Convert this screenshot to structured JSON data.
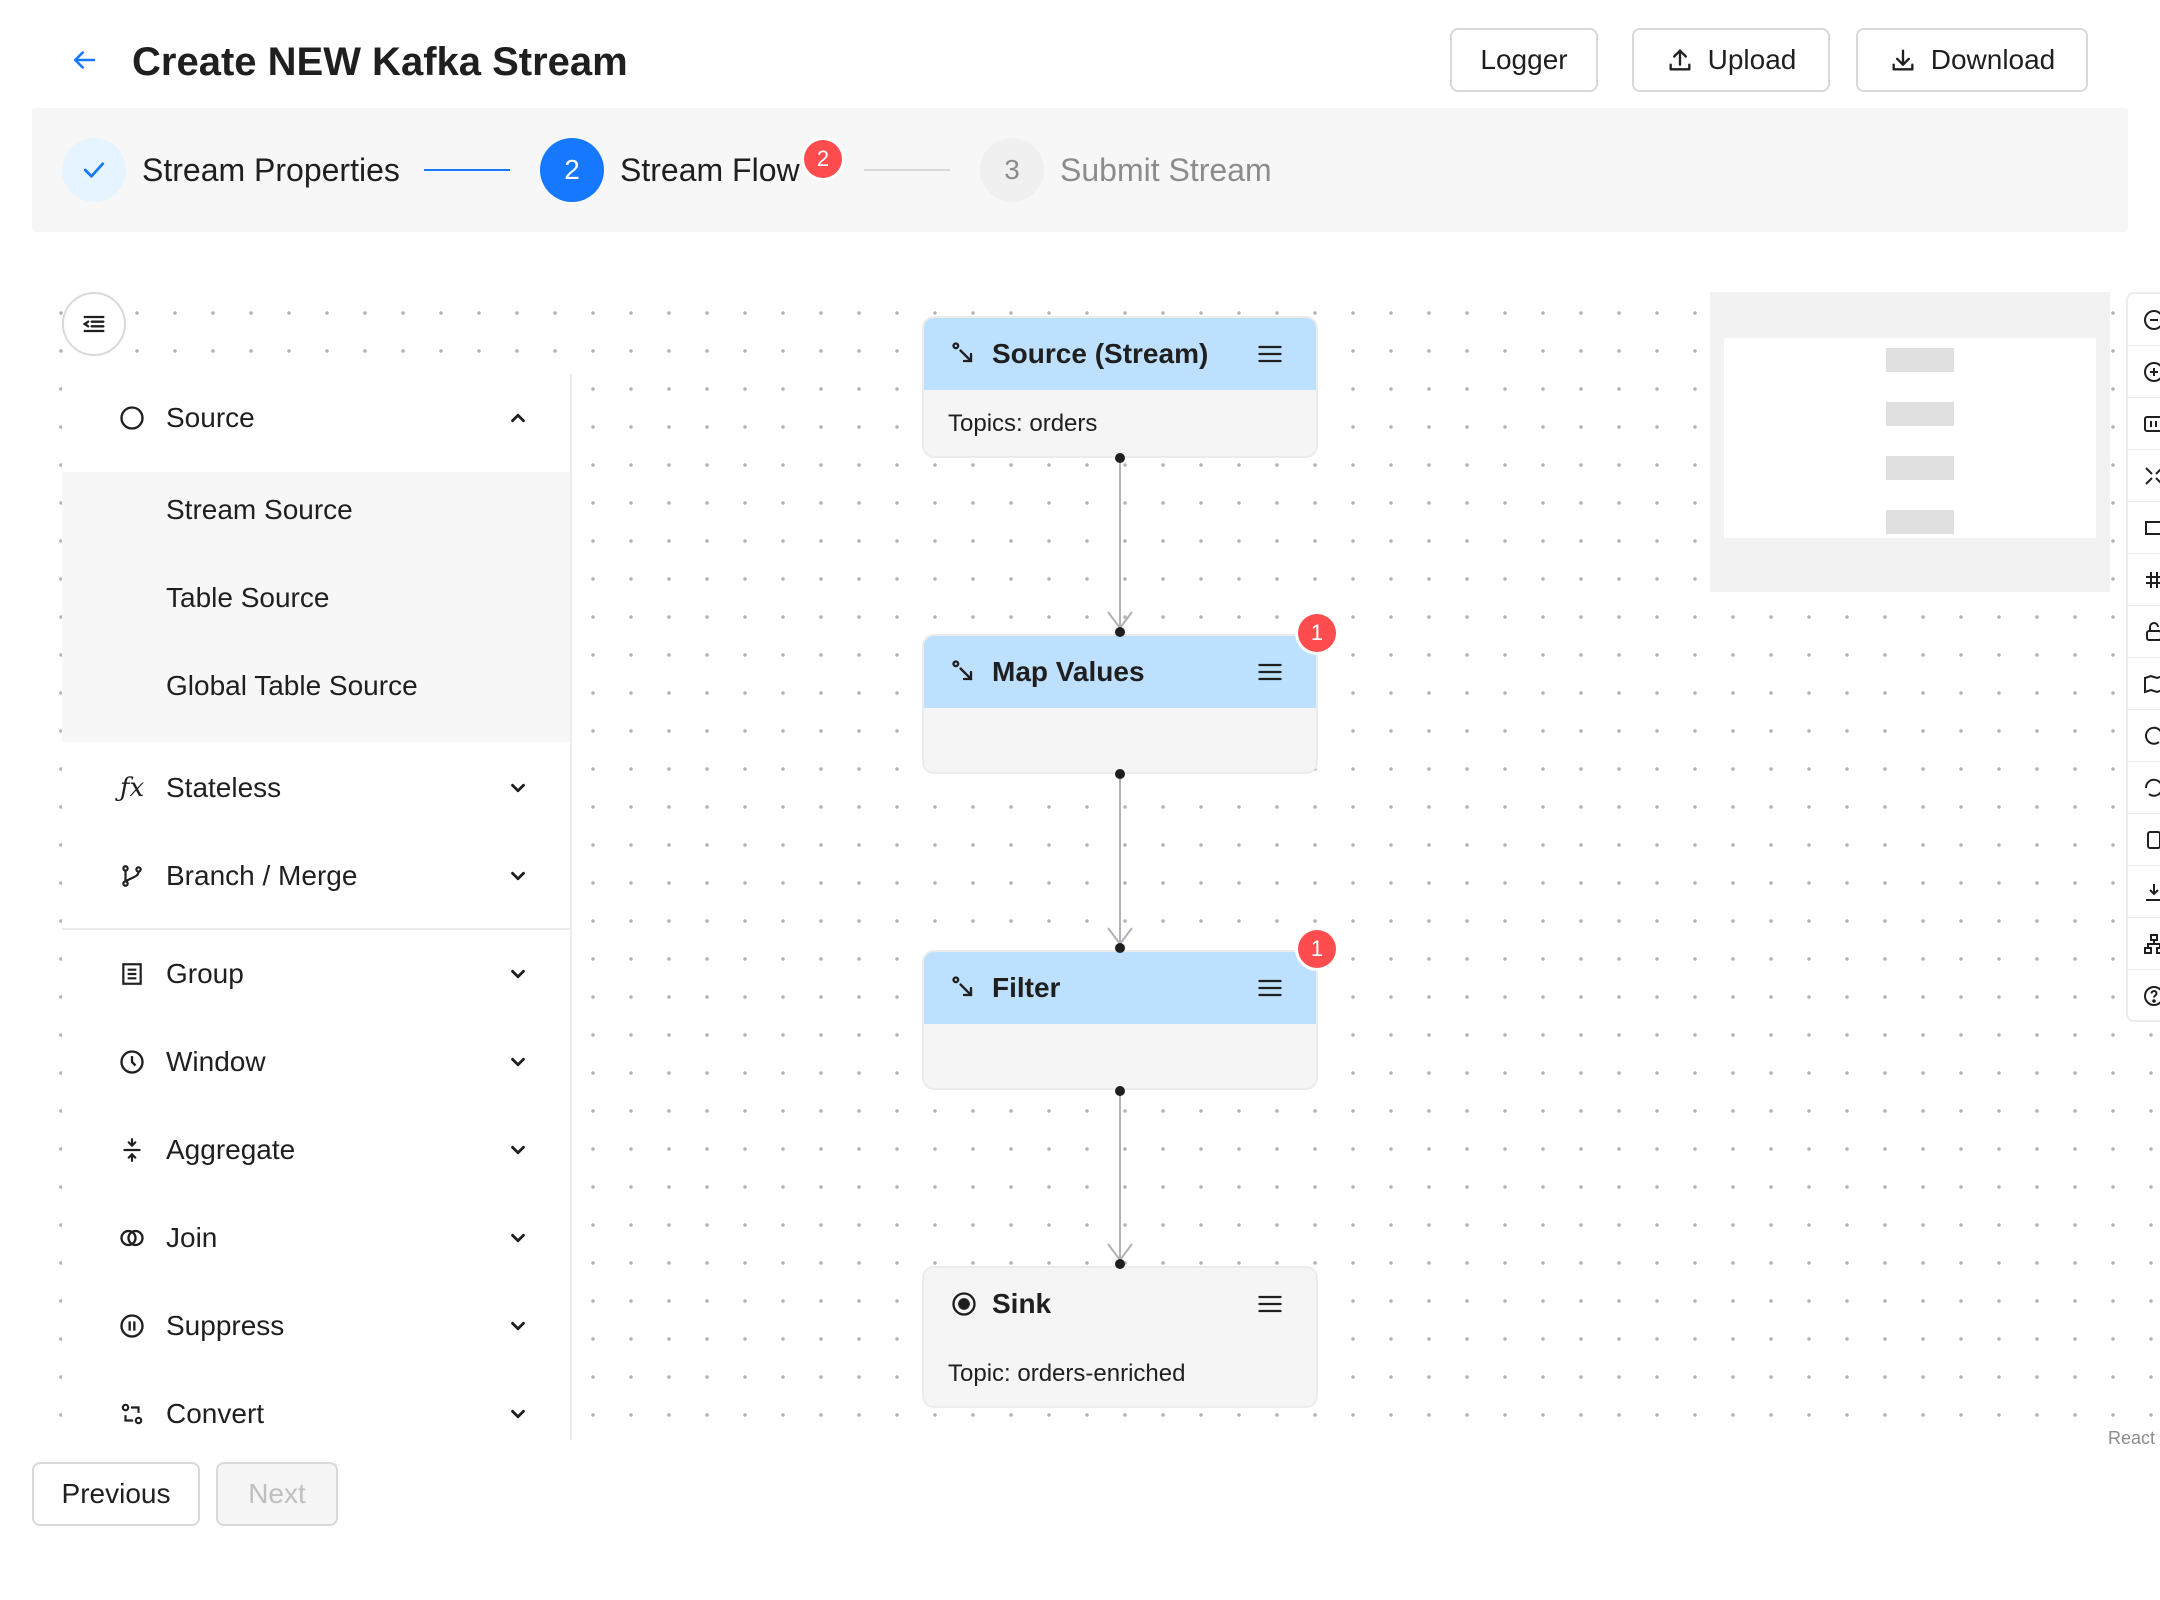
{
  "header": {
    "title": "Create NEW Kafka Stream",
    "back_icon": "arrow-left-icon",
    "buttons": {
      "logger": "Logger",
      "upload": "Upload",
      "download": "Download"
    }
  },
  "steps": [
    {
      "index": "1",
      "title": "Stream Properties",
      "status": "finish"
    },
    {
      "index": "2",
      "title": "Stream Flow",
      "status": "process",
      "badge": "2"
    },
    {
      "index": "3",
      "title": "Submit Stream",
      "status": "wait"
    }
  ],
  "sidebar": {
    "groups": [
      {
        "label": "Source",
        "icon": "circle-icon",
        "expanded": true,
        "children": [
          "Stream Source",
          "Table Source",
          "Global Table Source"
        ]
      },
      {
        "label": "Stateless",
        "icon": "function-icon"
      },
      {
        "label": "Branch / Merge",
        "icon": "branch-icon"
      },
      {
        "label": "Group",
        "icon": "group-icon"
      },
      {
        "label": "Window",
        "icon": "clock-icon"
      },
      {
        "label": "Aggregate",
        "icon": "aggregate-icon"
      },
      {
        "label": "Join",
        "icon": "join-icon"
      },
      {
        "label": "Suppress",
        "icon": "pause-icon"
      },
      {
        "label": "Convert",
        "icon": "convert-icon"
      }
    ]
  },
  "flow": {
    "nodes": [
      {
        "title": "Source (Stream)",
        "body": "Topics: orders",
        "type": "source"
      },
      {
        "title": "Map Values",
        "body": "",
        "badge": "1",
        "type": "operator"
      },
      {
        "title": "Filter",
        "body": "",
        "badge": "1",
        "type": "operator"
      },
      {
        "title": "Sink",
        "body": "Topic: orders-enriched",
        "type": "sink"
      }
    ],
    "attribution": "React"
  },
  "footer": {
    "previous": "Previous",
    "next": "Next"
  },
  "colors": {
    "primary": "#1677ff",
    "node_header": "#bde0fe",
    "badge": "#ff4d4f",
    "step_finish_bg": "#e6f4ff"
  }
}
